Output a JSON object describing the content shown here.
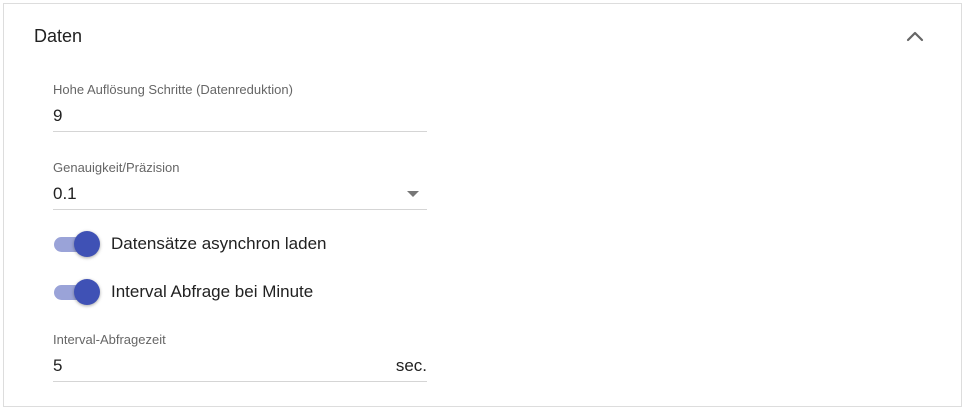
{
  "panel": {
    "title": "Daten",
    "collapse_icon": "chevron-up-icon"
  },
  "fields": {
    "resolution": {
      "label": "Hohe Auflösung Schritte (Datenreduktion)",
      "value": "9"
    },
    "precision": {
      "label": "Genauigkeit/Präzision",
      "value": "0.1",
      "dropdown_icon": "caret-down-icon"
    },
    "interval": {
      "label": "Interval-Abfragezeit",
      "value": "5",
      "unit": "sec."
    }
  },
  "toggles": {
    "async_load": {
      "label": "Datensätze asynchron laden",
      "checked": true
    },
    "interval_minute": {
      "label": "Interval Abfrage bei Minute",
      "checked": true
    }
  },
  "colors": {
    "accent": "#3f51b5",
    "track": "#9aa3d8"
  }
}
